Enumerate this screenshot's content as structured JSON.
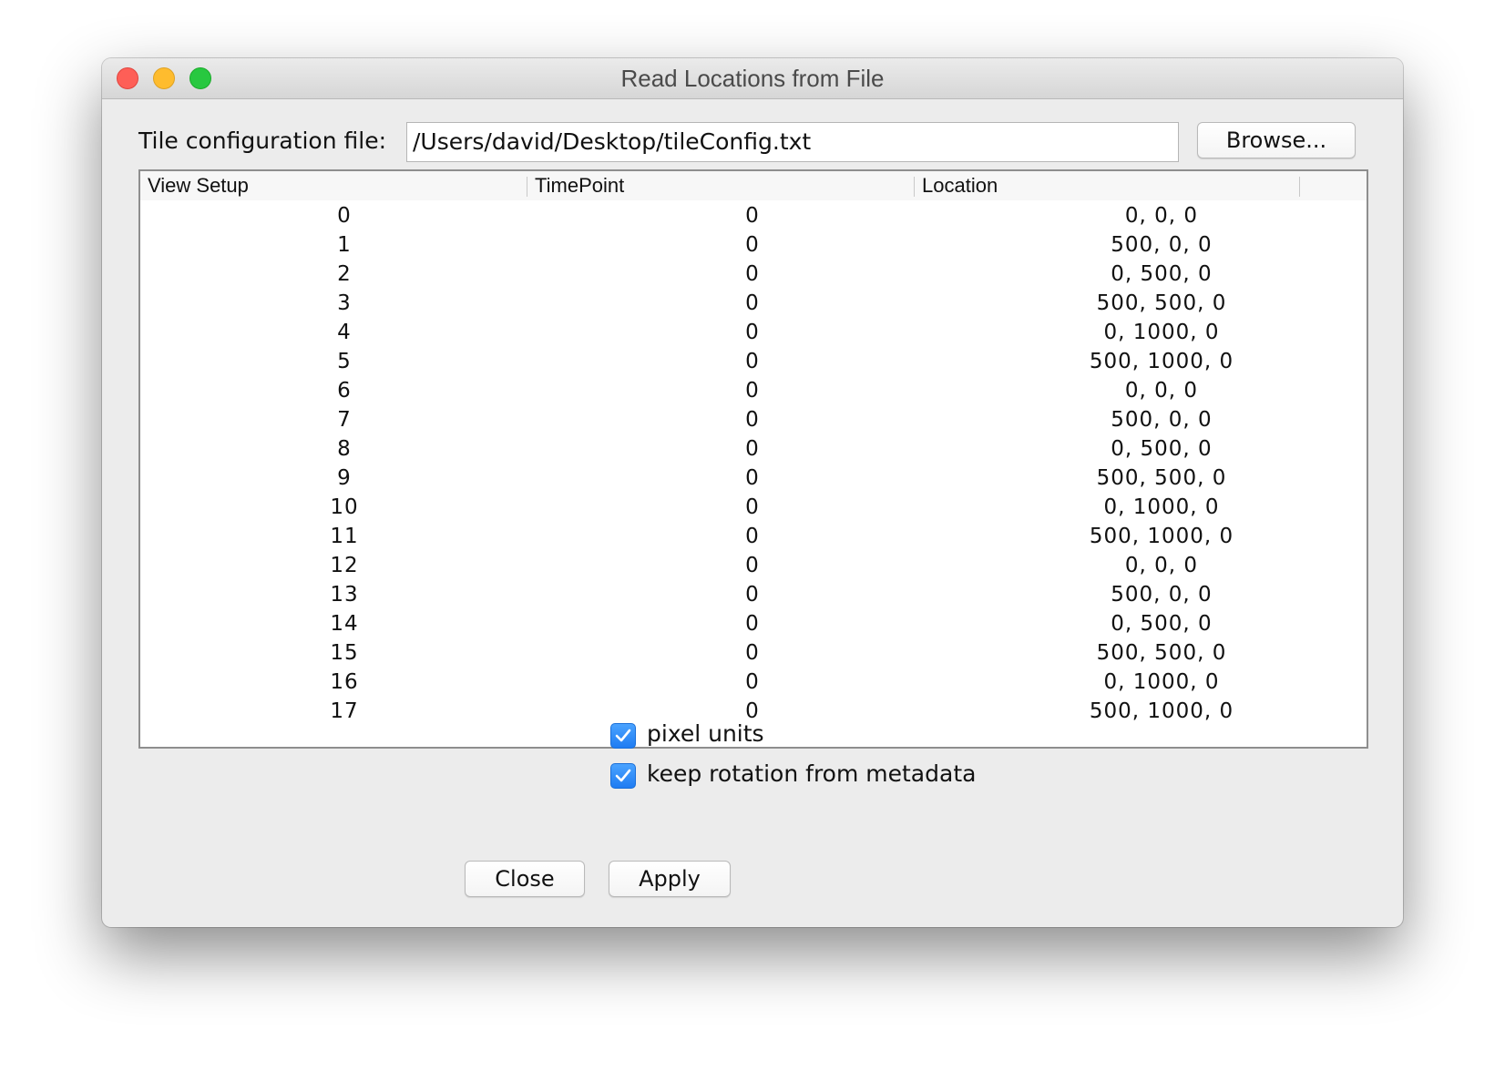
{
  "window": {
    "title": "Read Locations from File"
  },
  "file": {
    "label": "Tile configuration file:",
    "value": "/Users/david/Desktop/tileConfig.txt",
    "browse_label": "Browse..."
  },
  "table": {
    "columns": [
      "View Setup",
      "TimePoint",
      "Location"
    ],
    "rows": [
      [
        "0",
        "0",
        "0, 0, 0"
      ],
      [
        "1",
        "0",
        "500, 0, 0"
      ],
      [
        "2",
        "0",
        "0, 500, 0"
      ],
      [
        "3",
        "0",
        "500, 500, 0"
      ],
      [
        "4",
        "0",
        "0, 1000, 0"
      ],
      [
        "5",
        "0",
        "500, 1000, 0"
      ],
      [
        "6",
        "0",
        "0, 0, 0"
      ],
      [
        "7",
        "0",
        "500, 0, 0"
      ],
      [
        "8",
        "0",
        "0, 500, 0"
      ],
      [
        "9",
        "0",
        "500, 500, 0"
      ],
      [
        "10",
        "0",
        "0, 1000, 0"
      ],
      [
        "11",
        "0",
        "500, 1000, 0"
      ],
      [
        "12",
        "0",
        "0, 0, 0"
      ],
      [
        "13",
        "0",
        "500, 0, 0"
      ],
      [
        "14",
        "0",
        "0, 500, 0"
      ],
      [
        "15",
        "0",
        "500, 500, 0"
      ],
      [
        "16",
        "0",
        "0, 1000, 0"
      ],
      [
        "17",
        "0",
        "500, 1000, 0"
      ]
    ]
  },
  "options": {
    "pixel_units": {
      "label": "pixel units",
      "checked": true
    },
    "keep_rotation": {
      "label": "keep rotation from metadata",
      "checked": true
    }
  },
  "buttons": {
    "close_label": "Close",
    "apply_label": "Apply"
  },
  "colors": {
    "checkbox_accent": "#1f7cf2",
    "traffic_close": "#fe5f57",
    "traffic_minimize": "#febc2e",
    "traffic_maximize": "#28c840"
  }
}
